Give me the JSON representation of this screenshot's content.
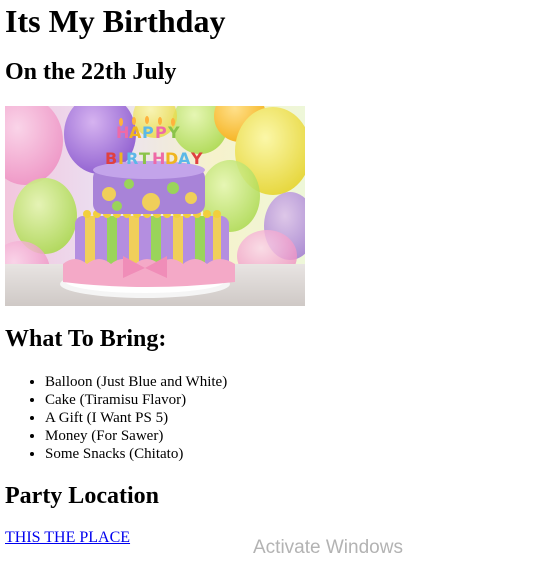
{
  "page": {
    "title": "Its My Birthday",
    "subtitle": "On the 22th July"
  },
  "photo": {
    "cake_lettering": "HAPPY BIRTHDAY"
  },
  "bring": {
    "heading": "What To Bring:",
    "items": [
      "Balloon (Just Blue and White)",
      "Cake (Tiramisu Flavor)",
      "A Gift (I Want PS 5)",
      "Money (For Sawer)",
      "Some Snacks (Chitato)"
    ]
  },
  "location": {
    "heading": "Party Location",
    "link_label": "THIS THE PLACE"
  },
  "os_overlay": {
    "watermark": "Activate Windows"
  }
}
